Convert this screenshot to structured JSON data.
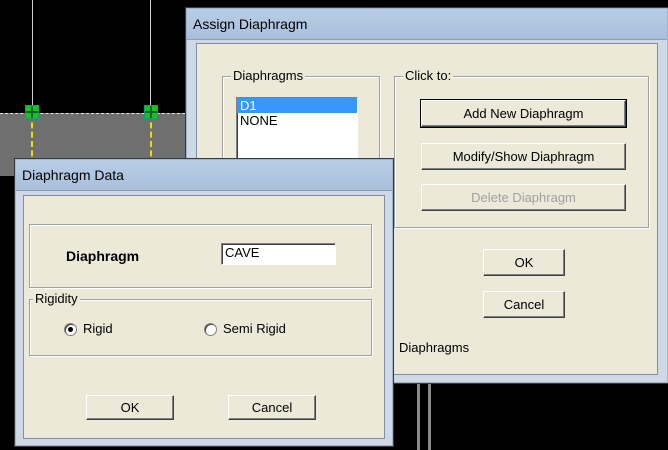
{
  "assign_dialog": {
    "title": "Assign Diaphragm",
    "diaphragms_legend": "Diaphragms",
    "clickto_legend": "Click to:",
    "list_items": [
      "D1",
      "NONE"
    ],
    "add_new": "Add New Diaphragm",
    "modify_show": "Modify/Show Diaphragm",
    "delete": "Delete Diaphragm",
    "ok": "OK",
    "cancel": "Cancel",
    "bottom_text": "Diaphragms"
  },
  "data_dialog": {
    "title": "Diaphragm Data",
    "diaphragm_label": "Diaphragm",
    "diaphragm_value": "CAVE",
    "rigidity_legend": "Rigidity",
    "rigid_label": "Rigid",
    "semi_rigid_label": "Semi Rigid",
    "rigidity_selected": "Rigid",
    "ok": "OK",
    "cancel": "Cancel"
  },
  "colors": {
    "titlebar": "#b9cde6",
    "dialog_face": "#ece9d8",
    "selection": "#3399ff",
    "node": "#1fbf1f",
    "dashed_line": "#e2e000"
  }
}
